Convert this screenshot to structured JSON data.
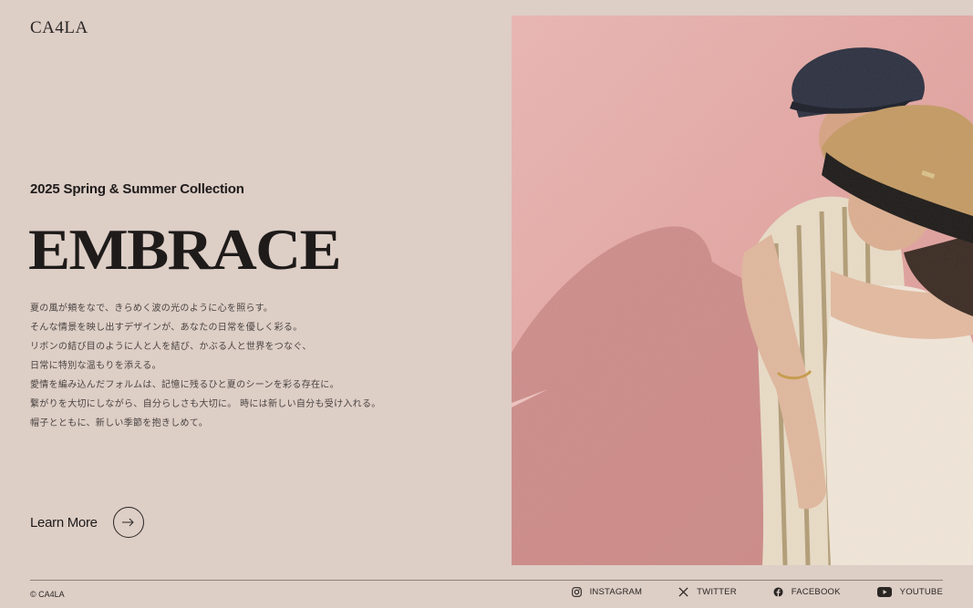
{
  "brand": {
    "logo": "CA4LA"
  },
  "hero": {
    "subtitle": "2025 Spring & Summer Collection",
    "headline": "EMBRACE",
    "body": [
      "夏の風が頬をなで、きらめく波の光のように心を照らす。",
      "そんな情景を映し出すデザインが、あなたの日常を優しく彩る。",
      "リボンの結び目のように人と人を結び、かぶる人と世界をつなぐ、",
      "日常に特別な温もりを添える。",
      "愛情を編み込んだフォルムは、記憶に残るひと夏のシーンを彩る存在に。",
      "繋がりを大切にしながら、自分らしさも大切に。 時には新しい自分も受け入れる。",
      "帽子とともに、新しい季節を抱きしめて。"
    ],
    "cta_label": "Learn More",
    "cta_icon": "arrow-right-icon"
  },
  "footer": {
    "copyright": "© CA4LA",
    "social": [
      {
        "label": "INSTAGRAM",
        "icon": "instagram-icon"
      },
      {
        "label": "TWITTER",
        "icon": "x-twitter-icon"
      },
      {
        "label": "FACEBOOK",
        "icon": "facebook-icon"
      },
      {
        "label": "YOUTUBE",
        "icon": "youtube-icon"
      }
    ]
  },
  "colors": {
    "background": "#ddcec6",
    "wall": "#e4a7a3",
    "text": "#1e1b1a"
  }
}
